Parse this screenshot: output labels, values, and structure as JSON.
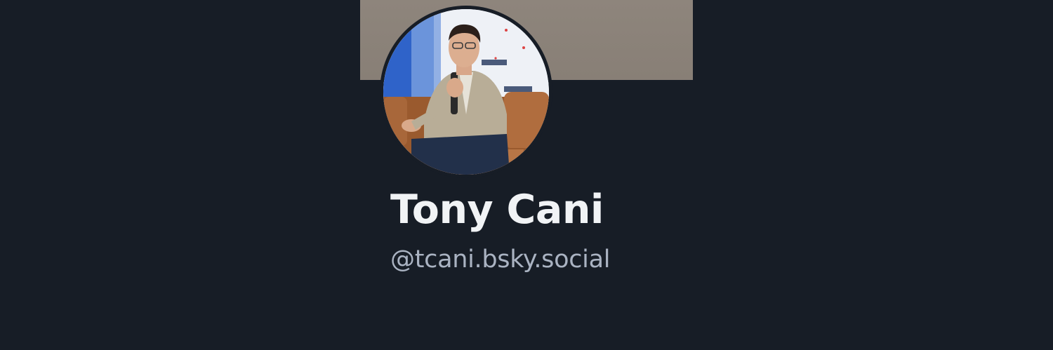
{
  "profile": {
    "display_name": "Tony Cani",
    "handle": "@tcani.bsky.social",
    "avatar_icon": "avatar-photo",
    "banner_color": "#8e857c"
  },
  "colors": {
    "background": "#171d26",
    "name_text": "#f1f3f5",
    "handle_text": "#aab3c2"
  }
}
